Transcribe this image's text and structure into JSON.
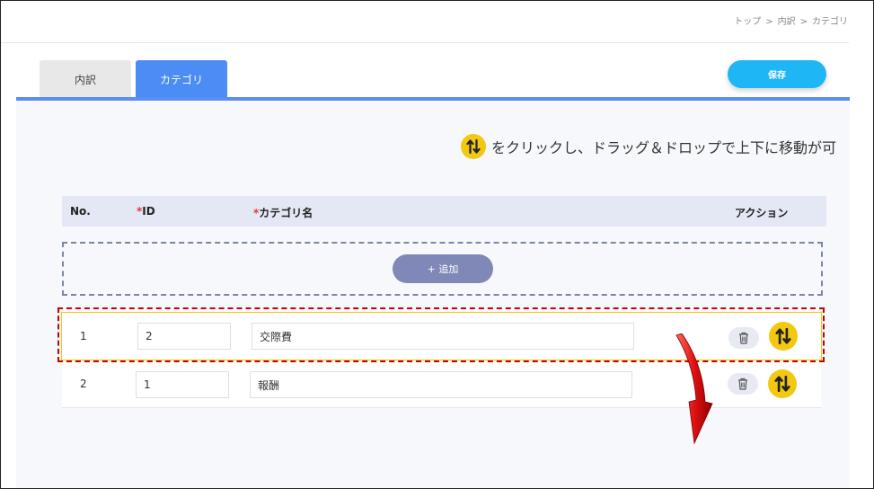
{
  "breadcrumb": [
    "トップ",
    "内訳",
    "カテゴリ"
  ],
  "breadcrumb_separator": ">",
  "tabs": [
    {
      "label": "内訳",
      "active": false
    },
    {
      "label": "カテゴリ",
      "active": true
    }
  ],
  "save_label": "保存",
  "hint": {
    "icon": "sort-arrows-icon",
    "text": "をクリックし、ドラッグ＆ドロップで上下に移動が可"
  },
  "table": {
    "headers": {
      "no": "No.",
      "id_required_mark": "*",
      "id": "ID",
      "name_required_mark": "*",
      "name": "カテゴリ名",
      "action": "アクション"
    },
    "add_label": "+ 追加",
    "rows": [
      {
        "no": "1",
        "id": "2",
        "name": "交際費"
      },
      {
        "no": "2",
        "id": "1",
        "name": "報酬"
      }
    ]
  },
  "colors": {
    "accent": "#4b8cf5",
    "save": "#1fb6f5",
    "drag_handle": "#f2c811",
    "highlight": "#cc0000",
    "add_button": "#7f88b6"
  }
}
